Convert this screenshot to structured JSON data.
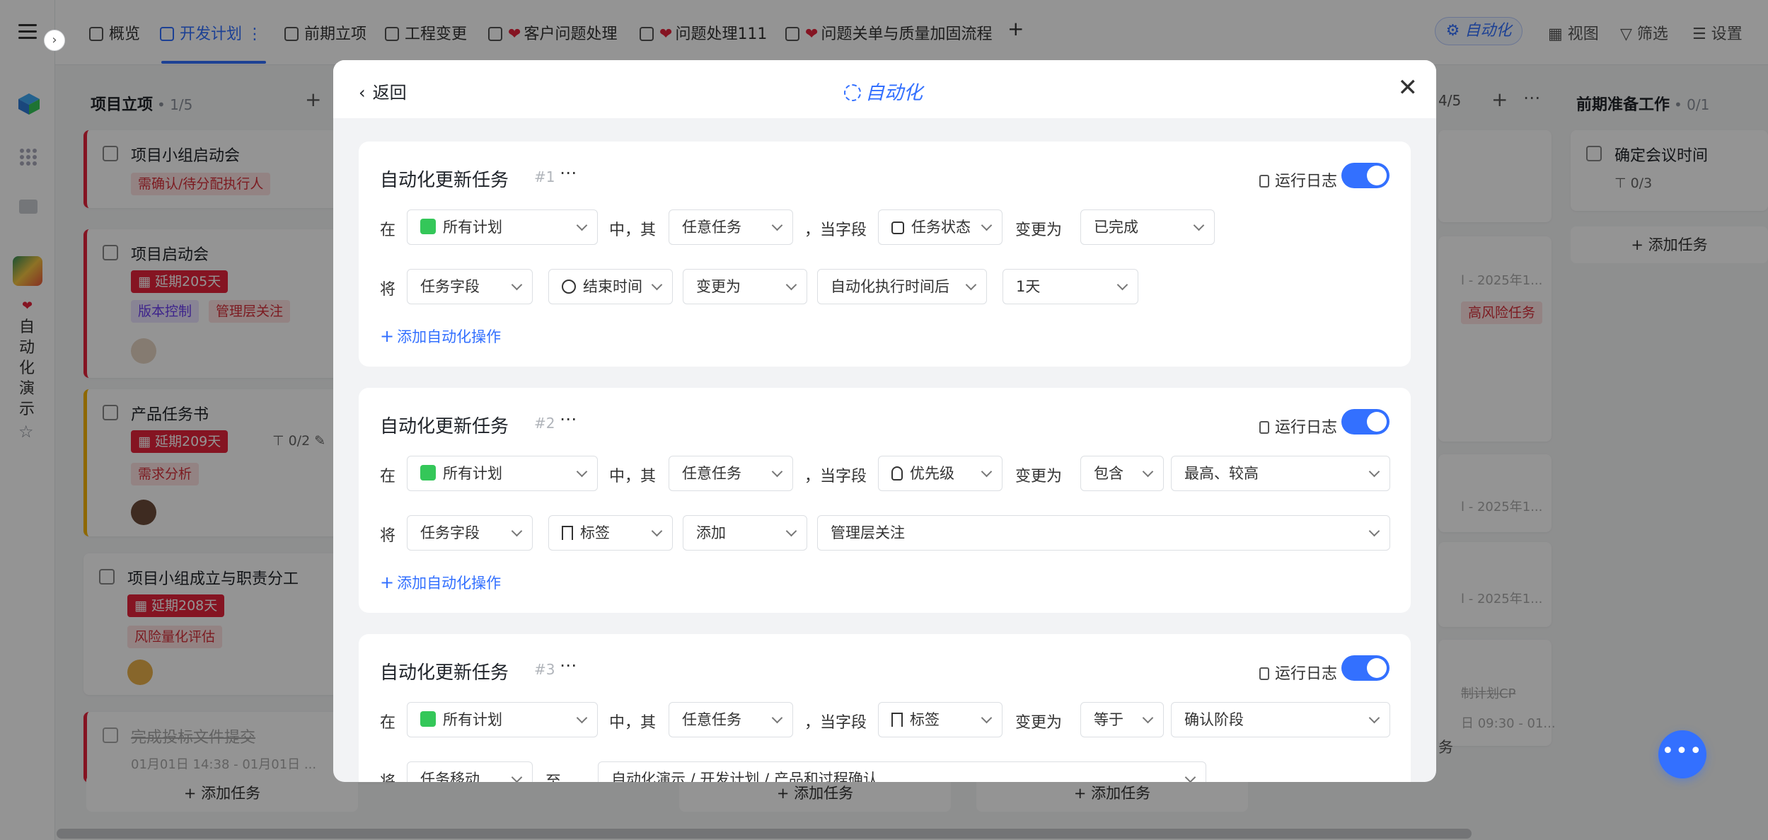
{
  "sidebar": {
    "project_label": "自动化演示"
  },
  "topbar": {
    "tabs": [
      {
        "label": "概览"
      },
      {
        "label": "开发计划"
      },
      {
        "label": "前期立项"
      },
      {
        "label": "工程变更"
      },
      {
        "label": "客户问题处理"
      },
      {
        "label": "问题处理111"
      },
      {
        "label": "问题关单与质量加固流程"
      }
    ],
    "add_tab_label": "+",
    "automation_label": "自动化",
    "view_label": "视图",
    "filter_label": "筛选",
    "settings_label": "设置"
  },
  "board": {
    "col1": {
      "title": "项目立项",
      "count": "• 1/5"
    },
    "col_hidden_count": "4/5",
    "col3": {
      "title": "前期准备工作",
      "count": "• 0/1"
    },
    "cards": [
      {
        "title": "项目小组启动会",
        "tags": [
          "需确认/待分配执行人"
        ]
      },
      {
        "title": "项目启动会",
        "delay": "延期205天",
        "tags": [
          "版本控制",
          "管理层关注"
        ]
      },
      {
        "title": "产品任务书",
        "delay": "延期209天",
        "subtask": "0/2",
        "tags": [
          "需求分析"
        ]
      },
      {
        "title": "项目小组成立与职责分工",
        "delay": "延期208天",
        "tags": [
          "风险量化评估"
        ]
      },
      {
        "title": "完成投标文件提交",
        "date": "01月01日 14:38 - 01月01日 ..."
      }
    ],
    "right_card": {
      "title": "确定会议时间",
      "subtask": "0/3"
    },
    "add_task_label": "添加任务",
    "faint_texts": [
      "l - 2025年1...",
      "高风险任务",
      "l - 2025年1...",
      "l - 2025年1...",
      "制计划CP",
      "日 09:30 - 01...",
      "务"
    ]
  },
  "modal": {
    "back_label": "返回",
    "title": "自动化",
    "rules": [
      {
        "name": "自动化更新任务",
        "num": "#1",
        "log_label": "运行日志",
        "enabled": true,
        "row1": {
          "in_label": "在",
          "plan": "所有计划",
          "mid_label": "中，其",
          "task": "任意任务",
          "field_label": "，当字段",
          "field": "任务状态",
          "changed_label": "变更为",
          "value": "已完成"
        },
        "row2": {
          "set_label": "将",
          "target": "任务字段",
          "field": "结束时间",
          "op": "变更为",
          "value": "自动化执行时间后",
          "extra": "1天"
        },
        "add_label": "添加自动化操作"
      },
      {
        "name": "自动化更新任务",
        "num": "#2",
        "log_label": "运行日志",
        "enabled": true,
        "row1": {
          "in_label": "在",
          "plan": "所有计划",
          "mid_label": "中，其",
          "task": "任意任务",
          "field_label": "，当字段",
          "field": "优先级",
          "changed_label": "变更为",
          "cond": "包含",
          "value": "最高、较高"
        },
        "row2": {
          "set_label": "将",
          "target": "任务字段",
          "field": "标签",
          "op": "添加",
          "value": "管理层关注"
        },
        "add_label": "添加自动化操作"
      },
      {
        "name": "自动化更新任务",
        "num": "#3",
        "log_label": "运行日志",
        "enabled": true,
        "row1": {
          "in_label": "在",
          "plan": "所有计划",
          "mid_label": "中，其",
          "task": "任意任务",
          "field_label": "，当字段",
          "field": "标签",
          "changed_label": "变更为",
          "cond": "等于",
          "value": "确认阶段"
        },
        "row2": {
          "set_label": "将",
          "target": "任务移动",
          "to_label": "至",
          "value": "自动化演示 / 开发计划 / 产品和过程确认"
        }
      }
    ]
  },
  "colors": {
    "accent": "#3370ff",
    "danger": "#e5243b",
    "toggle_on": "#3370ff"
  }
}
